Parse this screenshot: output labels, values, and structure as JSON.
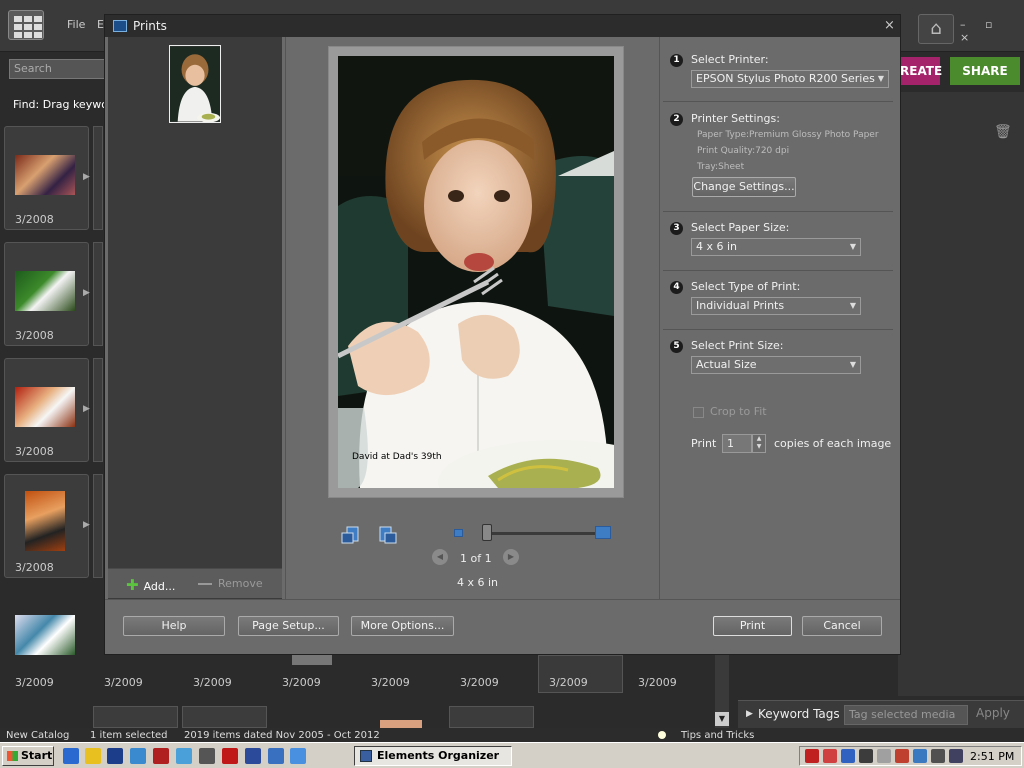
{
  "organizer": {
    "menu_file": "File",
    "menu_e": "E",
    "search_placeholder": "Search",
    "find_text": "Find: Drag keywo",
    "create_label": "REATE",
    "share_label": "SHARE",
    "thumb_dates": [
      "3/2008",
      "3/2008",
      "3/2008",
      "3/2008"
    ],
    "bottom_dates": [
      "3/2009",
      "3/2009",
      "3/2009",
      "3/2009",
      "3/2009",
      "3/2009",
      "3/2009",
      "3/2009"
    ],
    "keyword_tags_label": "Keyword Tags",
    "tag_input_placeholder": "Tag selected media",
    "apply_label": "Apply",
    "status": {
      "catalog": "New Catalog",
      "selected": "1 item selected",
      "items": "2019 items dated Nov 2005 - Oct 2012",
      "tips": "Tips and Tricks"
    }
  },
  "dialog": {
    "title": "Prints",
    "close_glyph": "×",
    "left": {
      "add_label": "Add...",
      "remove_label": "Remove"
    },
    "preview": {
      "caption": "David at Dad's 39th",
      "page_count": "1 of 1",
      "size_label": "4 x 6 in"
    },
    "steps": {
      "printer": {
        "num": "1",
        "label": "Select Printer:",
        "value": "EPSON Stylus Photo R200 Series"
      },
      "settings": {
        "num": "2",
        "label": "Printer Settings:",
        "paper_type": "Paper Type:Premium Glossy Photo Paper",
        "quality": "Print Quality:720 dpi",
        "tray": "Tray:Sheet",
        "change_button": "Change Settings..."
      },
      "paper_size": {
        "num": "3",
        "label": "Select Paper Size:",
        "value": "4 x 6 in"
      },
      "print_type": {
        "num": "4",
        "label": "Select Type of Print:",
        "value": "Individual Prints"
      },
      "print_size": {
        "num": "5",
        "label": "Select Print Size:",
        "value": "Actual Size",
        "crop_label": "Crop to Fit",
        "print_label": "Print",
        "copies": "1",
        "copies_suffix": "copies of each image"
      }
    },
    "footer": {
      "help": "Help",
      "page_setup": "Page Setup...",
      "more_options": "More Options...",
      "print": "Print",
      "cancel": "Cancel"
    }
  },
  "taskbar": {
    "start_label": "Start",
    "task_label": "Elements Organizer",
    "clock": "2:51 PM"
  }
}
